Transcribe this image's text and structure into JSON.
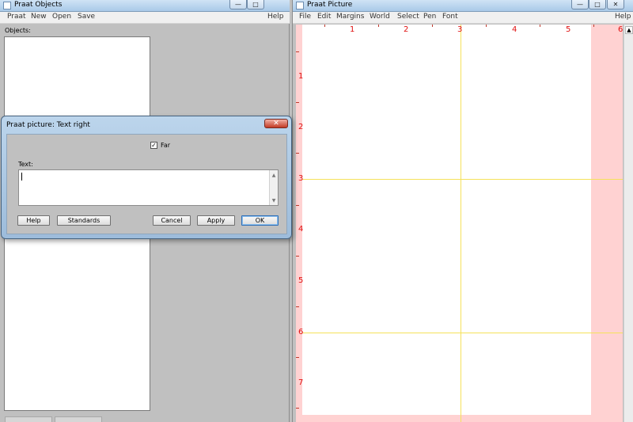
{
  "objects_window": {
    "title": "Praat Objects",
    "menu": [
      "Praat",
      "New",
      "Open",
      "Save"
    ],
    "help": "Help",
    "objects_label": "Objects:",
    "minimize_glyph": "—",
    "maximize_glyph": "□"
  },
  "picture_window": {
    "title": "Praat Picture",
    "menu": [
      "File",
      "Edit",
      "Margins",
      "World",
      "Select",
      "Pen",
      "Font"
    ],
    "help": "Help",
    "minimize_glyph": "—",
    "maximize_glyph": "□",
    "close_glyph": "✕",
    "scroll_up_glyph": "▲",
    "top_ruler": [
      "1",
      "2",
      "3",
      "4",
      "5",
      "6"
    ],
    "left_ruler": [
      "1",
      "2",
      "3",
      "4",
      "5",
      "6",
      "7"
    ],
    "colors": {
      "margin": "#ffd2d2",
      "viewport": "#ffffff",
      "selection_lines": "#f5e15a",
      "ruler": "#e01010"
    }
  },
  "dialog": {
    "title": "Praat picture: Text right",
    "close_glyph": "✕",
    "far_label": "Far",
    "far_checked": true,
    "far_check_glyph": "✓",
    "text_label": "Text:",
    "text_value": "",
    "scroll_up_glyph": "▲",
    "scroll_down_glyph": "▼",
    "buttons": {
      "help": "Help",
      "standards": "Standards",
      "cancel": "Cancel",
      "apply": "Apply",
      "ok": "OK"
    }
  }
}
